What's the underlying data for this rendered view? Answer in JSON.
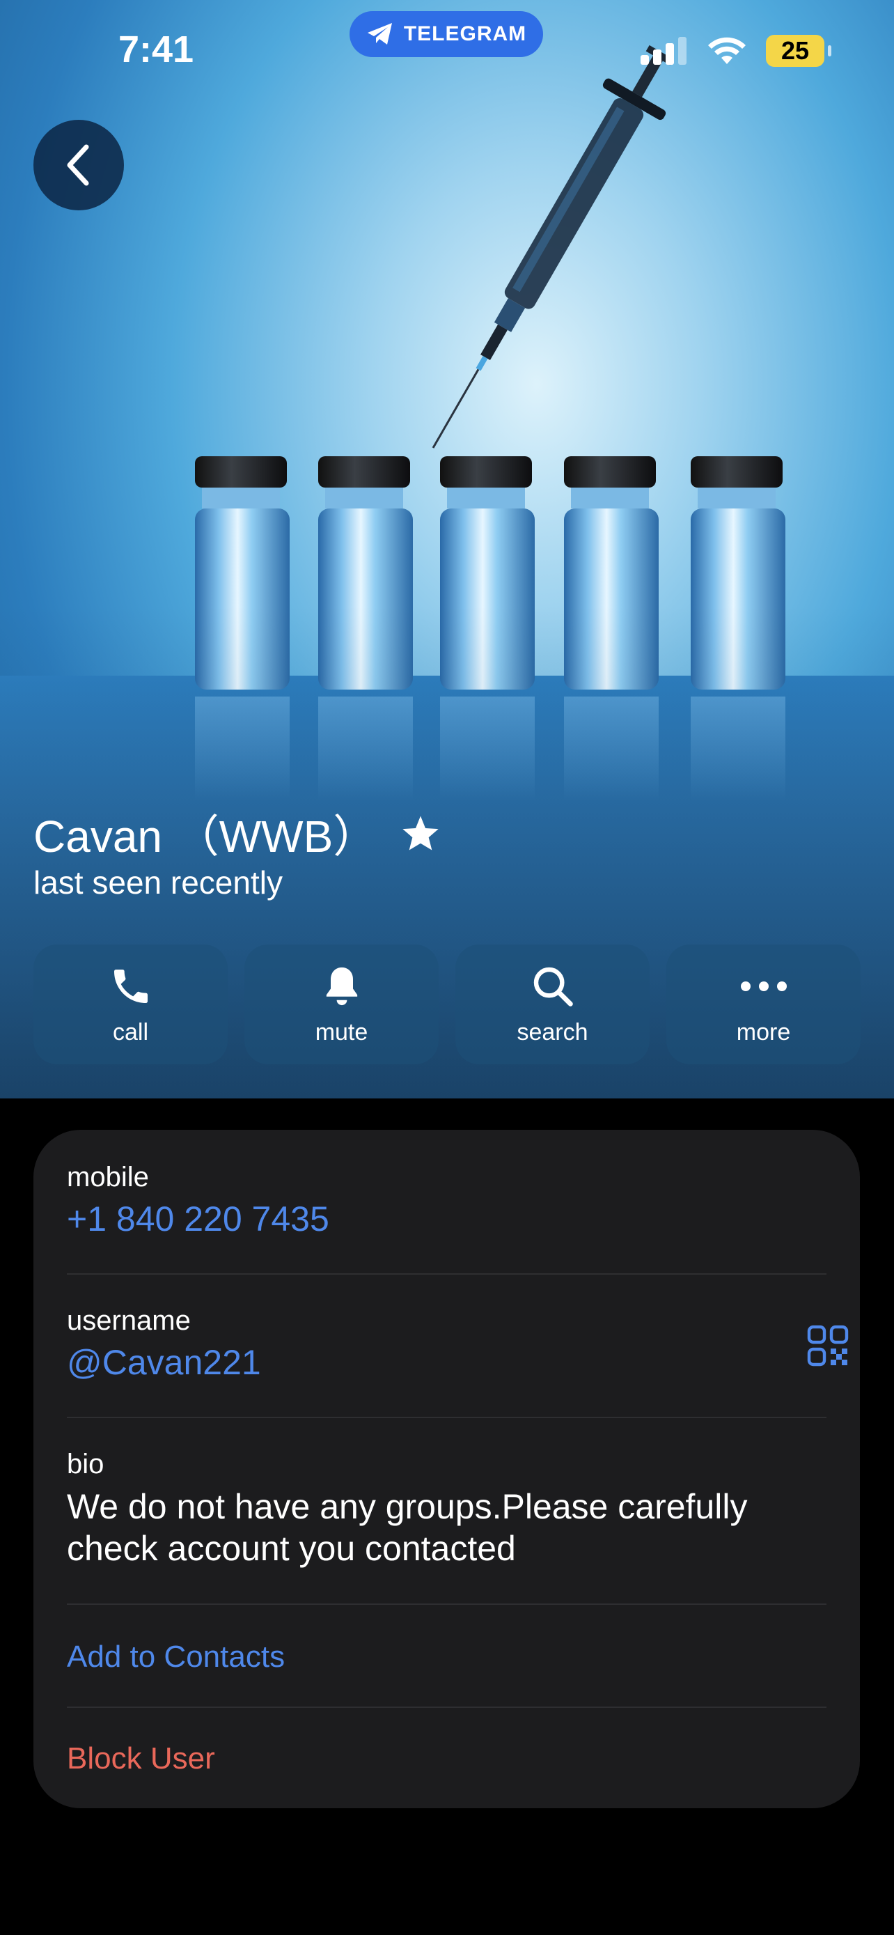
{
  "status_bar": {
    "time": "7:41",
    "app_pill": "TELEGRAM",
    "battery": "25"
  },
  "profile": {
    "name": "Cavan （WWB）",
    "status": "last seen recently"
  },
  "actions": [
    {
      "label": "call",
      "icon": "phone-icon"
    },
    {
      "label": "mute",
      "icon": "bell-icon"
    },
    {
      "label": "search",
      "icon": "search-icon"
    },
    {
      "label": "more",
      "icon": "ellipsis-icon"
    }
  ],
  "info": {
    "mobile_label": "mobile",
    "mobile_value": "+1 840 220 7435",
    "username_label": "username",
    "username_value": "@Cavan221",
    "bio_label": "bio",
    "bio_value": "We do not have any groups.Please carefully check account you contacted",
    "add_contact": "Add to Contacts",
    "block_user": "Block User"
  },
  "colors": {
    "accent": "#4f88ea",
    "danger": "#e9685a",
    "card_bg": "#1c1c1e",
    "pill": "#2f6ee6",
    "battery": "#f4d648"
  }
}
